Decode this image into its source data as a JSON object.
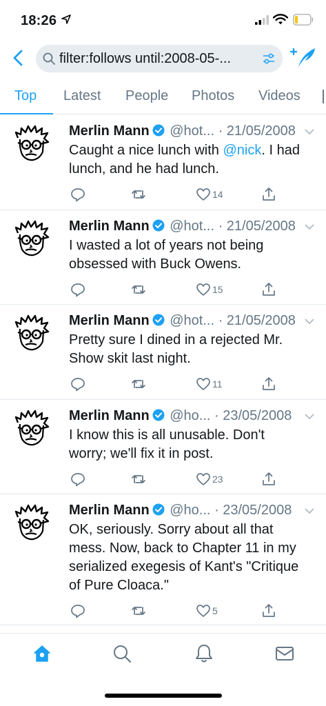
{
  "status_bar": {
    "time": "18:26"
  },
  "search": {
    "query": "filter:follows until:2008-05-..."
  },
  "tabs": [
    {
      "label": "Top",
      "active": true
    },
    {
      "label": "Latest",
      "active": false
    },
    {
      "label": "People",
      "active": false
    },
    {
      "label": "Photos",
      "active": false
    },
    {
      "label": "Videos",
      "active": false
    }
  ],
  "tweets": [
    {
      "author": "Merlin Mann",
      "meta": "@hot... · 21/05/2008",
      "text_before": "Caught a nice lunch with ",
      "mention": "@nick",
      "text_after": ". I had lunch, and he had lunch.",
      "likes": "14"
    },
    {
      "author": "Merlin Mann",
      "meta": "@hot... · 21/05/2008",
      "text_before": "I wasted a lot of years not being obsessed with Buck Owens.",
      "mention": "",
      "text_after": "",
      "likes": "15"
    },
    {
      "author": "Merlin Mann",
      "meta": "@hot... · 21/05/2008",
      "text_before": "Pretty sure I dined in a rejected Mr. Show skit last night.",
      "mention": "",
      "text_after": "",
      "likes": "11"
    },
    {
      "author": "Merlin Mann",
      "meta": "@ho... · 23/05/2008",
      "text_before": "I know this is all unusable. Don't worry; we'll fix it in post.",
      "mention": "",
      "text_after": "",
      "likes": "23"
    },
    {
      "author": "Merlin Mann",
      "meta": "@ho... · 23/05/2008",
      "text_before": "OK, seriously. Sorry about all that mess. Now, back to Chapter 11 in my serialized exegesis of Kant's \"Critique of Pure Cloaca.\"",
      "mention": "",
      "text_after": "",
      "likes": "5"
    }
  ],
  "icons": {
    "back": "chevron-left-icon",
    "search": "search-icon",
    "filter": "filter-sliders-icon",
    "compose": "compose-tweet-icon",
    "reply": "reply-icon",
    "retweet": "retweet-icon",
    "like": "heart-icon",
    "share": "share-icon",
    "nav": [
      "home-icon",
      "search-icon",
      "notifications-icon",
      "messages-icon"
    ]
  },
  "colors": {
    "accent": "#1da1f2",
    "muted": "#657786",
    "text": "#14171a",
    "divider": "#e1e8ed"
  }
}
